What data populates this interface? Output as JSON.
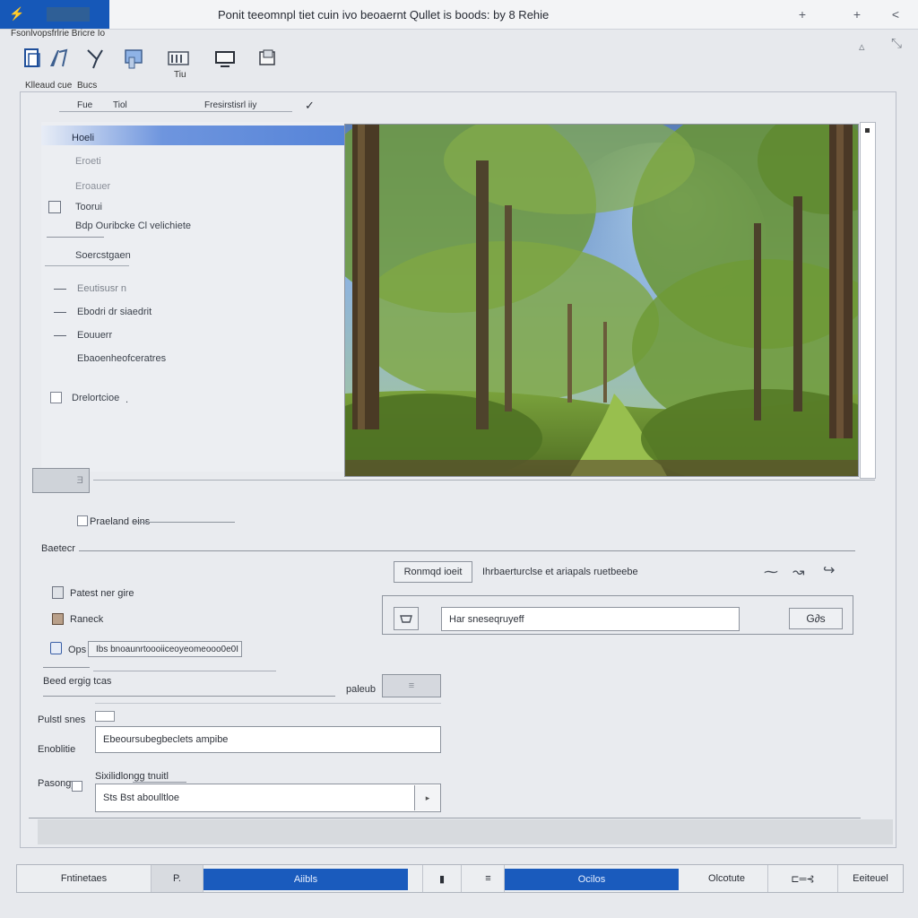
{
  "window": {
    "title": "Ponit teeomnpl tiet cuin ivo beoaernt Qullet is boods: by 8 Rehie",
    "controls": [
      "+",
      "+",
      "<"
    ]
  },
  "ribbon": {
    "menu_caption": "Fsonlvopsfrlrie Bricre Io",
    "group_label_1": "Klleaud cue",
    "group_label_2": "Bucs",
    "icon_caption": "Tiu",
    "icons": [
      "document-icon",
      "edit-icon",
      "pin-icon",
      "paste-icon",
      "frame-icon",
      "crop-icon",
      "export-icon"
    ],
    "collapse_glyphs": [
      "▵",
      "⤡"
    ]
  },
  "panel_header": {
    "col1": "Fue",
    "col2": "Tiol",
    "col3": "Fresirstisrl iiy",
    "check": "✓"
  },
  "tree": {
    "items": [
      "Hoeli",
      "Eroeti",
      "Eroauer",
      "Toorui",
      "Bdp  Ouribcke  Cl velichiete",
      "Soercstgaen",
      "Eeutisusr  n",
      "Ebodri dr siaedrit",
      "Eouuerr",
      "Ebaoenheofceratres"
    ],
    "checkbox_label": "Drelortcioe",
    "checkbox_suffix": "."
  },
  "preview": {
    "image_alt": "forest path with tall trees and blue sky"
  },
  "small_button": "Ǝ",
  "options": {
    "checkbox_label": "Praeland eins",
    "section_label": "Baetecr",
    "items": [
      {
        "label": "Patest ner gire",
        "icon": "page-icon"
      },
      {
        "label": "Raneck",
        "icon": "box-icon"
      },
      {
        "label": "Ops",
        "icon": "doc-icon"
      }
    ],
    "ops_value": "Ibs bnoaunrtoooiiceoyeomeooo0e0I"
  },
  "action_group": {
    "button": "Ronmqd ioeit",
    "description": "Ihrbaerturclse et ariapals ruetbeebe",
    "input_value": "Har   sneseqruyeff",
    "go_button": "G∂s",
    "icon_left": "tray-icon",
    "deco_icons": [
      "wave-icon",
      "curve-icon",
      "hook-icon"
    ]
  },
  "form": {
    "section_label": "Beed ergig tcas",
    "right_label": "paleub",
    "spin_value": "≡",
    "rows": [
      {
        "label": "Pulstl snes",
        "value": ""
      },
      {
        "label": "Enoblitie",
        "value": "Ebeoursubegbeclets ampibe"
      },
      {
        "label": "Pasongy",
        "value": "Sts  Bst aboulltloe",
        "hint": "Sixilidlongg tnuitl"
      }
    ]
  },
  "statusbar": {
    "left_label": "Fntinetaes",
    "icon_1": "P.",
    "blue_1": "Aiibls",
    "icon_2": "▮",
    "icon_3": "≡",
    "blue_2": "Ocilos",
    "right_label": "Olcotute",
    "icon_4": "⊏═⊰",
    "end_label": "Eeiteuel"
  }
}
